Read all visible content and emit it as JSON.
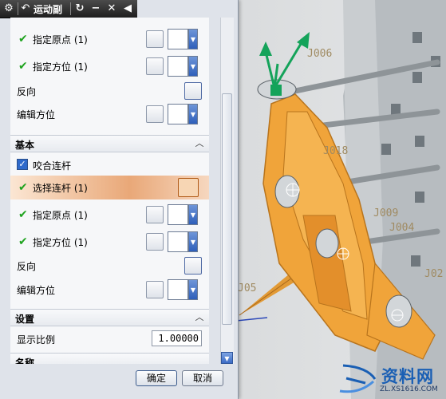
{
  "dialog": {
    "title": "运动副",
    "ok_label": "确定",
    "cancel_label": "取消"
  },
  "rows_top": {
    "origin_label": "指定原点 (1)",
    "vector_label": "指定方位 (1)",
    "reverse_label": "反向",
    "edit_orient_label": "编辑方位"
  },
  "base_section": {
    "title": "基本",
    "engage_link_label": "咬合连杆",
    "engage_link_checked": true,
    "select_link_label": "选择连杆 (1)",
    "origin_label": "指定原点 (1)",
    "vector_label": "指定方位 (1)",
    "reverse_label": "反向",
    "edit_orient_label": "编辑方位"
  },
  "settings_section": {
    "title": "设置",
    "scale_label": "显示比例",
    "scale_value": "1.00000"
  },
  "name_section": {
    "title": "名称"
  },
  "viewport": {
    "labels": [
      "J006",
      "J018",
      "J009",
      "J004",
      "J02",
      "J05"
    ]
  },
  "watermark": {
    "brand": "资料网",
    "url": "ZL.XS1616.COM"
  },
  "colors": {
    "part_orange": "#f0a43a",
    "check_green": "#1fa31f",
    "highlight": "#e9a878",
    "axis_green": "#14a35a"
  }
}
